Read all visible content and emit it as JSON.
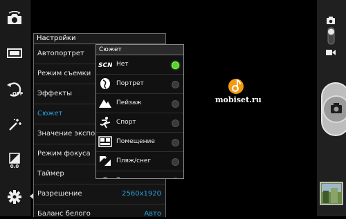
{
  "settings": {
    "title": "Настройки",
    "rows": [
      {
        "label": "Автопортрет",
        "value": ""
      },
      {
        "label": "Режим съемки",
        "value": ""
      },
      {
        "label": "Эффекты",
        "value": ""
      },
      {
        "label": "Сюжет",
        "value": ""
      },
      {
        "label": "Значение экспозиции",
        "value": ""
      },
      {
        "label": "Режим фокуса",
        "value": ""
      },
      {
        "label": "Таймер",
        "value": ""
      },
      {
        "label": "Разрешение",
        "value": "2560x1920"
      },
      {
        "label": "Баланс белого",
        "value": "Авто"
      }
    ]
  },
  "scene": {
    "title": "Сюжет",
    "options": [
      {
        "label": "Нет",
        "icon": "scn-icon",
        "selected": true
      },
      {
        "label": "Портрет",
        "icon": "portrait-icon",
        "selected": false
      },
      {
        "label": "Пейзаж",
        "icon": "landscape-icon",
        "selected": false
      },
      {
        "label": "Спорт",
        "icon": "sport-icon",
        "selected": false
      },
      {
        "label": "Помещение",
        "icon": "indoor-icon",
        "selected": false
      },
      {
        "label": "Пляж/снег",
        "icon": "beach-snow-icon",
        "selected": false
      },
      {
        "label": "Закат",
        "icon": "sunset-icon",
        "selected": false
      }
    ]
  },
  "left_toolbar": {
    "exposure_value": "0.0",
    "flash_off_label": "OFF"
  },
  "watermark": {
    "text": "mobiset.ru"
  },
  "colors": {
    "accent": "#2aa3e0",
    "selected_radio": "#57d32a",
    "logo_orange": "#f39a12"
  }
}
